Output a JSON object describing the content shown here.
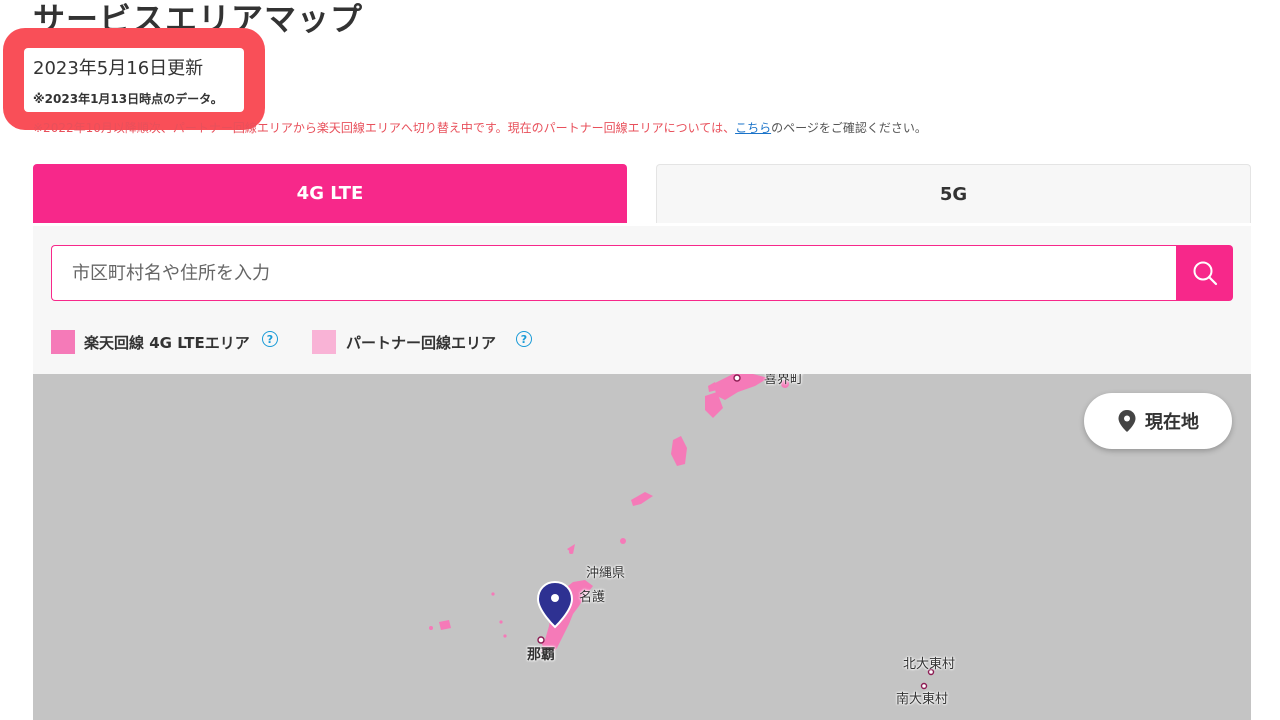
{
  "page": {
    "title": "サービスエリアマップ",
    "updated": "2023年5月16日更新",
    "data_note": "※2023年1月13日時点のデータ。",
    "switch_note_prefix": "※2022年10月以降順次、パートナー回線エリアから楽天回線エリアへ切り替え中です。現在のパートナー回線エリアについては、",
    "switch_note_link": "こちら",
    "switch_note_suffix": "のページをご確認ください。"
  },
  "tabs": [
    {
      "label": "4G LTE",
      "active": true
    },
    {
      "label": "5G",
      "active": false
    }
  ],
  "search": {
    "placeholder": "市区町村名や住所を入力",
    "icon": "search-icon"
  },
  "legend": [
    {
      "label": "楽天回線 4G LTEエリア",
      "color": "#f57ab8",
      "icon": "help-icon"
    },
    {
      "label": "パートナー回線エリア",
      "color": "#f9b3d6",
      "icon": "help-icon"
    }
  ],
  "map": {
    "locate_label": "現在地",
    "locate_icon": "location-pin-icon",
    "marker_icon": "map-marker-icon",
    "places": [
      {
        "name": "喜界町"
      },
      {
        "name": "沖縄県"
      },
      {
        "name": "名護"
      },
      {
        "name": "那覇"
      },
      {
        "name": "北大東村"
      },
      {
        "name": "南大東村"
      }
    ]
  },
  "colors": {
    "accent": "#f7288a",
    "highlight": "#f94f58",
    "link": "#1a73c9",
    "map_bg": "#c4c4c4",
    "area_main": "#f57ab8"
  }
}
